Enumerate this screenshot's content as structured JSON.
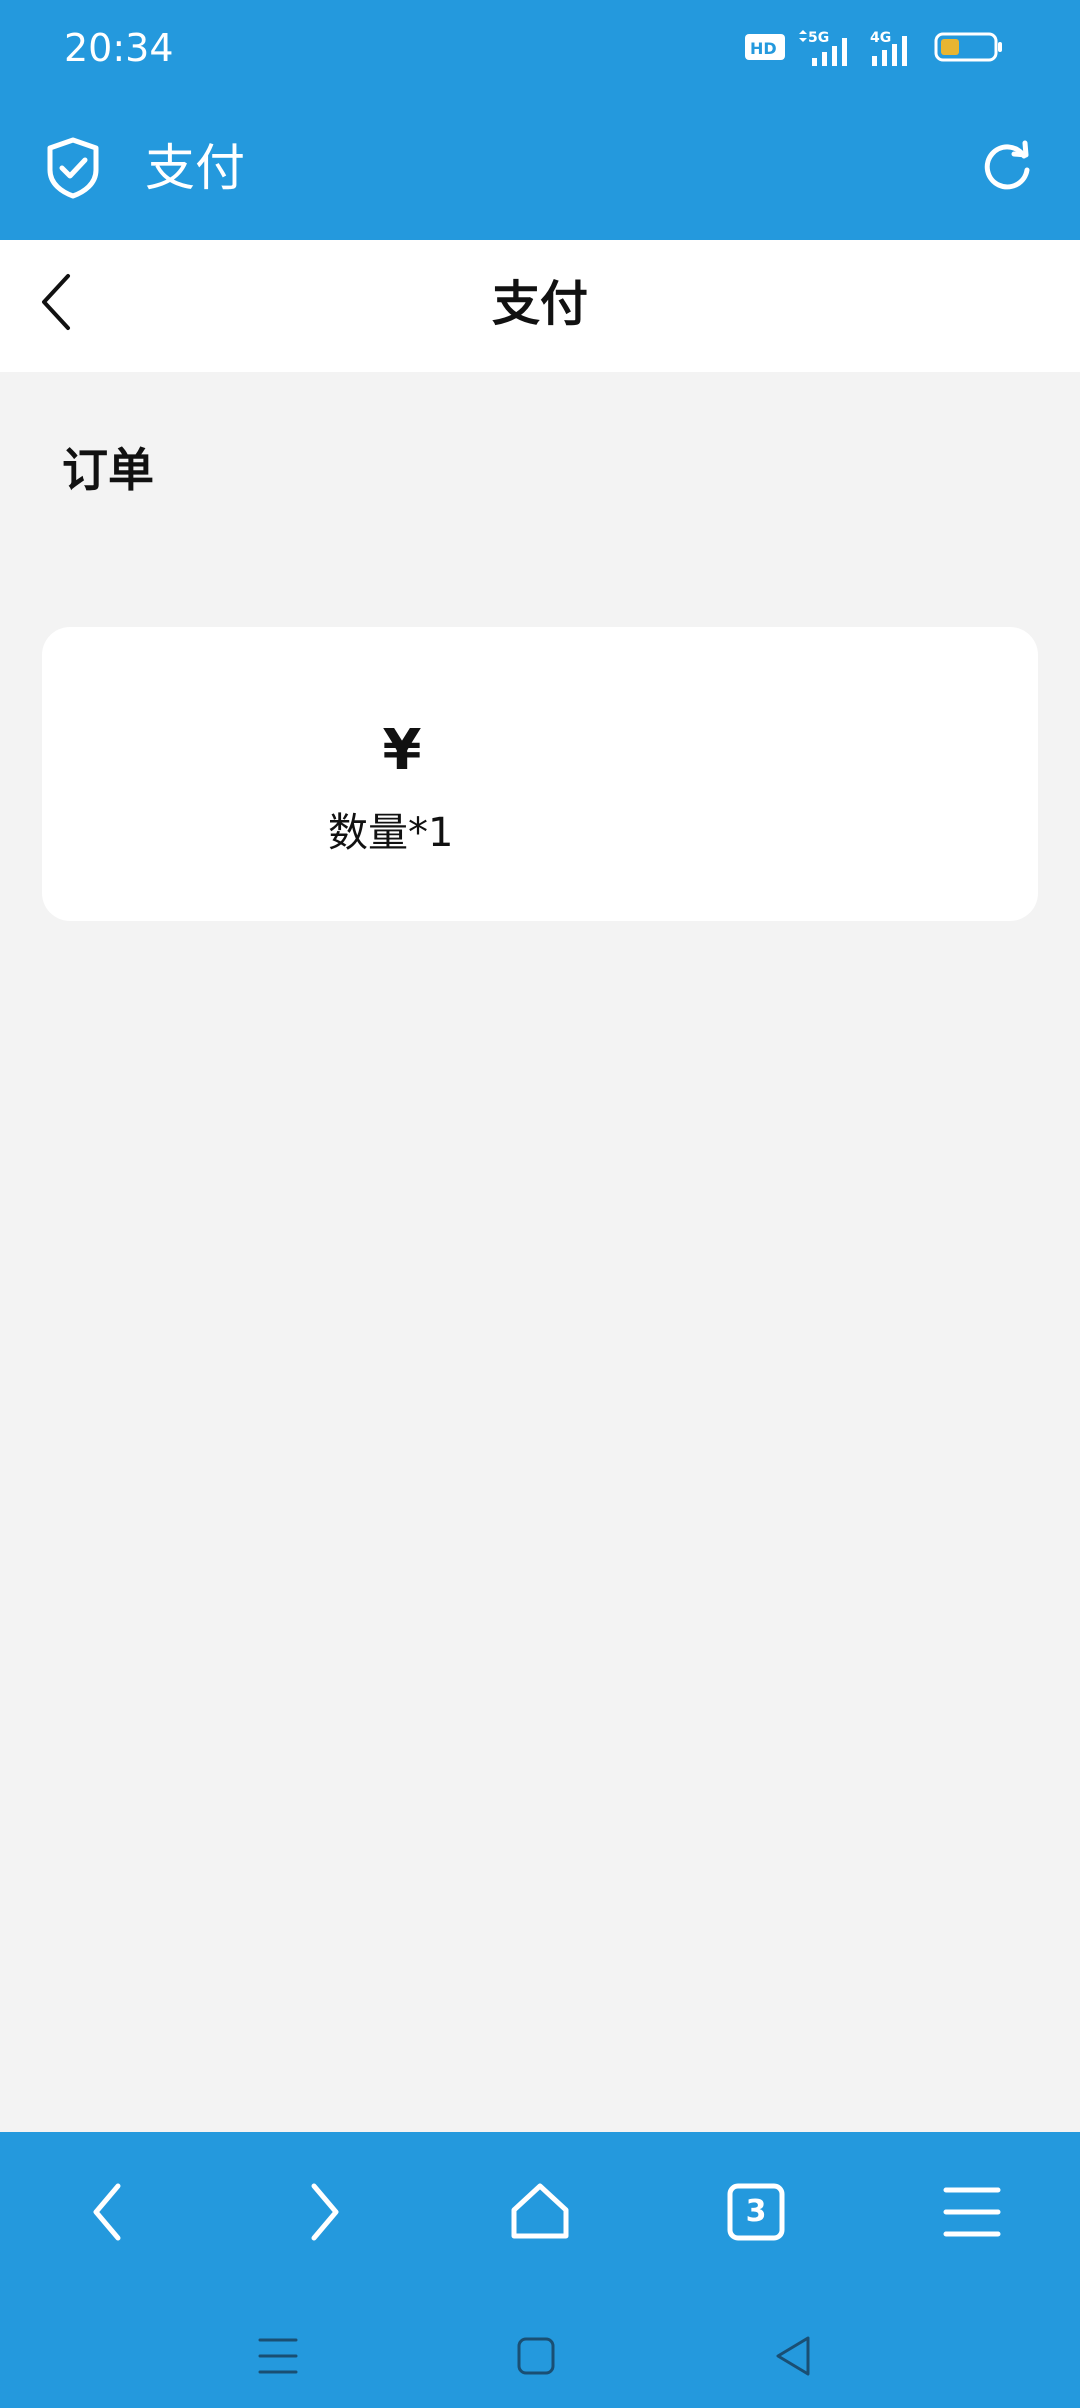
{
  "status_bar": {
    "time": "20:34",
    "hd_badge": "HD",
    "network_1": "5G",
    "network_2": "4G",
    "battery_color": "#e8b531"
  },
  "app_bar": {
    "title": "支付",
    "left_icon": "shield-check-icon",
    "right_icon": "refresh-icon"
  },
  "page_header": {
    "title": "支付",
    "back_icon": "chevron-left-icon"
  },
  "section": {
    "label": "订单"
  },
  "order": {
    "price": "¥",
    "quantity": "数量*1"
  },
  "browser_toolbar": {
    "tabs_count": "3",
    "items": [
      "back-icon",
      "forward-icon",
      "home-icon",
      "tabs-icon",
      "menu-icon"
    ]
  },
  "system_nav": {
    "items": [
      "recents-icon",
      "home-square-icon",
      "back-triangle-icon"
    ]
  },
  "colors": {
    "accent": "#2499dd",
    "background": "#f3f3f3",
    "card": "#ffffff"
  }
}
